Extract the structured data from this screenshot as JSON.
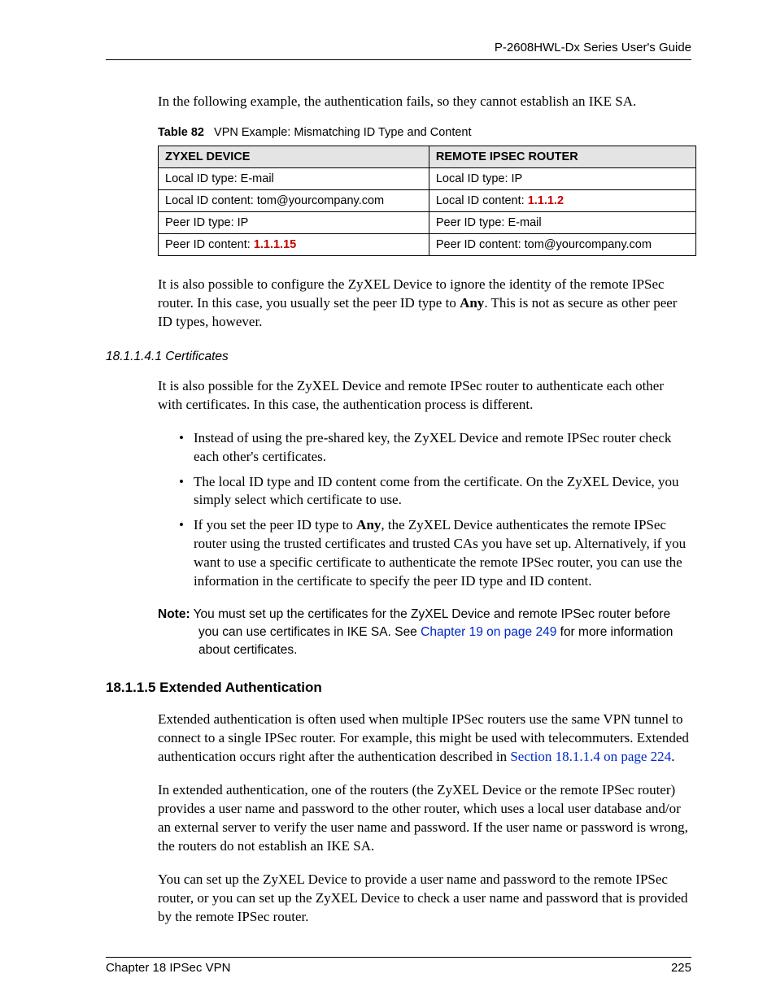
{
  "header": {
    "guide_title": "P-2608HWL-Dx Series User's Guide"
  },
  "para_intro": "In the following example, the authentication fails, so they cannot establish an IKE SA.",
  "table82": {
    "caption_label": "Table 82",
    "caption_text": "VPN Example: Mismatching ID Type and Content",
    "col1_header": "ZYXEL DEVICE",
    "col2_header": "REMOTE IPSEC ROUTER",
    "r1c1": "Local ID type: E-mail",
    "r1c2": "Local ID type: IP",
    "r2c1_pre": "Local ID content: tom@yourcompany.com",
    "r2c2_pre": "Local ID content: ",
    "r2c2_val": "1.1.1.2",
    "r3c1": "Peer ID type: IP",
    "r3c2": "Peer ID type: E-mail",
    "r4c1_pre": "Peer ID content: ",
    "r4c1_val": "1.1.1.15",
    "r4c2": "Peer ID content: tom@yourcompany.com"
  },
  "para_ignore_pre": "It is also possible to configure the ZyXEL Device to ignore the identity of the remote IPSec router. In this case, you usually set the peer ID type to ",
  "para_ignore_bold": "Any",
  "para_ignore_post": ". This is not as secure as other peer ID types, however.",
  "h_certs": "18.1.1.4.1  Certificates",
  "para_certs": "It is also possible for the ZyXEL Device and remote IPSec router to authenticate each other with certificates. In this case, the authentication process is different.",
  "bullets": {
    "b1": "Instead of using the pre-shared key, the ZyXEL Device and remote IPSec router check each other's certificates.",
    "b2": "The local ID type and ID content come from the certificate. On the ZyXEL Device, you simply select which certificate to use.",
    "b3_pre": "If you set the peer ID type to ",
    "b3_bold": "Any",
    "b3_post": ", the ZyXEL Device authenticates the remote IPSec router using the trusted certificates and trusted CAs you have set up. Alternatively, if you want to use a specific certificate to authenticate the remote IPSec router, you can use the information in the certificate to specify the peer ID type and ID content."
  },
  "note": {
    "label": "Note:",
    "pre": " You must set up the certificates for the ZyXEL Device and remote IPSec router before you can use certificates in IKE SA. See ",
    "link": "Chapter 19 on page 249",
    "post": " for more information about certificates."
  },
  "h_extauth": "18.1.1.5  Extended Authentication",
  "para_ext1_pre": "Extended authentication is often used when multiple IPSec routers use the same VPN tunnel to connect to a single IPSec router. For example, this might be used with telecommuters. Extended authentication occurs right after the authentication described in ",
  "para_ext1_link": "Section 18.1.1.4 on page 224",
  "para_ext1_post": ".",
  "para_ext2": "In extended authentication, one of the routers (the ZyXEL Device or the remote IPSec router) provides a user name and password to the other router, which uses a local user database and/or an external server to verify the user name and password. If the user name or password is wrong, the routers do not establish an IKE SA.",
  "para_ext3": "You can set up the ZyXEL Device to provide a user name and password to the remote IPSec router, or you can set up the ZyXEL Device to check a user name and password that is provided by the remote IPSec router.",
  "footer": {
    "chapter": "Chapter 18 IPSec VPN",
    "page": "225"
  }
}
